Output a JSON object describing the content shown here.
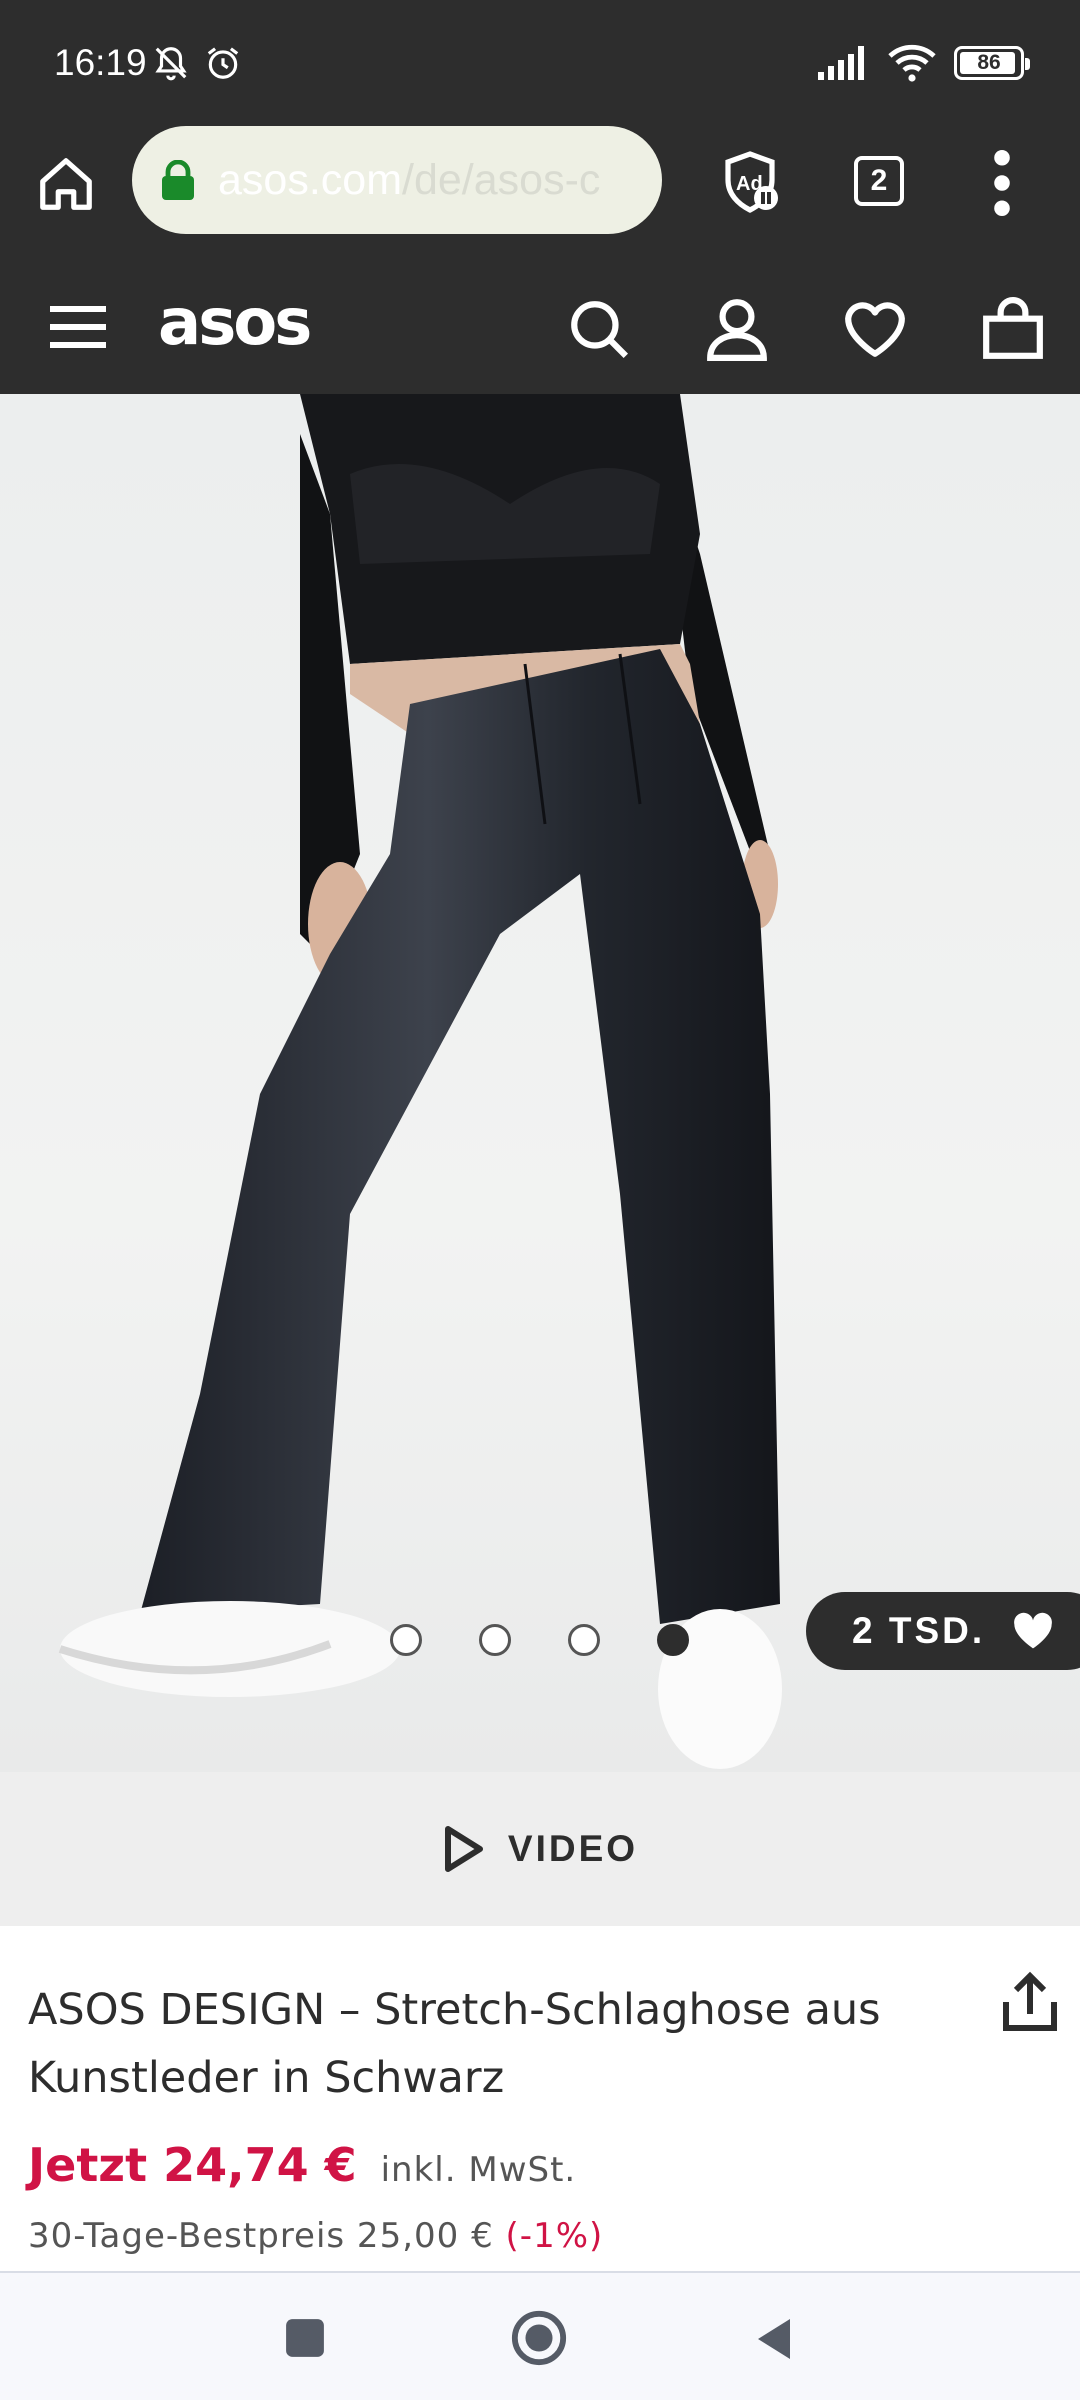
{
  "status_bar": {
    "time": "16:19",
    "battery_level": "86",
    "icons": [
      "notifications-muted-icon",
      "alarm-icon",
      "signal-icon",
      "wifi-icon",
      "battery-icon"
    ]
  },
  "browser": {
    "url_host": "asos.com",
    "url_path": "/de/asos-c",
    "tab_count": "2",
    "icons": [
      "home-icon",
      "lock-icon",
      "adblock-icon",
      "tabs-icon",
      "menu-icon"
    ]
  },
  "site_nav": {
    "logo": "asos",
    "icons": [
      "hamburger-menu-icon",
      "search-icon",
      "account-icon",
      "wishlist-icon",
      "bag-icon"
    ]
  },
  "gallery": {
    "wishlist_count": "2 TSD.",
    "image_count": 4,
    "active_index": 3
  },
  "video": {
    "label": "VIDEO"
  },
  "product": {
    "title": "ASOS DESIGN – Stretch-Schlaghose aus Kunstleder in Schwarz",
    "price": "Jetzt 24,74 €",
    "tax_note": "inkl. MwSt.",
    "lowest_price_text": "30-Tage-Bestpreis 25,00 €",
    "discount": "(-1%)"
  },
  "colors": {
    "dark": "#2d2d2d",
    "sale_red": "#d01345",
    "url_pill": "#eef0e4",
    "lock_green": "#1a8a2a"
  }
}
